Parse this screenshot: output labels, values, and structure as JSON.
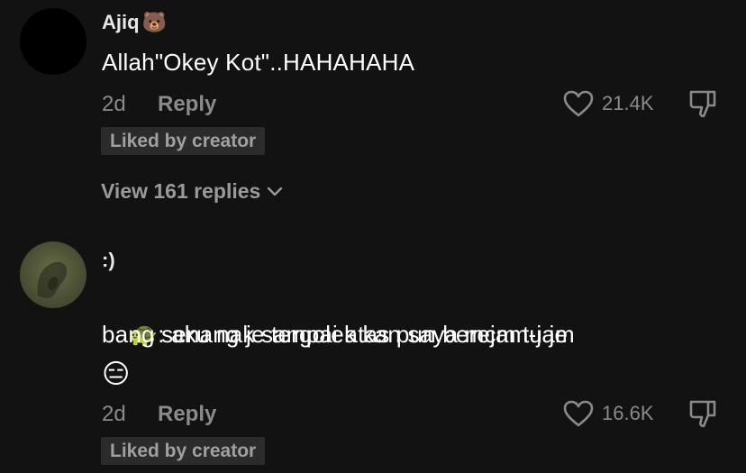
{
  "comments": [
    {
      "username": "Ajiq",
      "username_emoji": "🐻",
      "text": "Allah\"Okey Kot\"..HAHAHAHA",
      "time": "2d",
      "reply_label": "Reply",
      "likes": "21.4K",
      "liked_by_label": "Liked by creator",
      "view_replies_label": "View 161 replies"
    },
    {
      "username": ":)",
      "text_emoji": "🐢",
      "text_line1": ": aku nak sampai atas pun berejam-jam",
      "text_line2": "bang senang je tergolek kan saya mcm tu je",
      "trailing_emoji": "😑",
      "time": "2d",
      "reply_label": "Reply",
      "likes": "16.6K",
      "liked_by_label": "Liked by creator"
    }
  ],
  "colors": {
    "background": "#121212",
    "text_primary": "#ffffff",
    "text_secondary": "#8a8a8a",
    "badge_bg": "#2b2b2b"
  },
  "icons": {
    "like": "heart-outline-icon",
    "dislike": "thumbs-down-icon",
    "expand": "chevron-down-icon"
  }
}
